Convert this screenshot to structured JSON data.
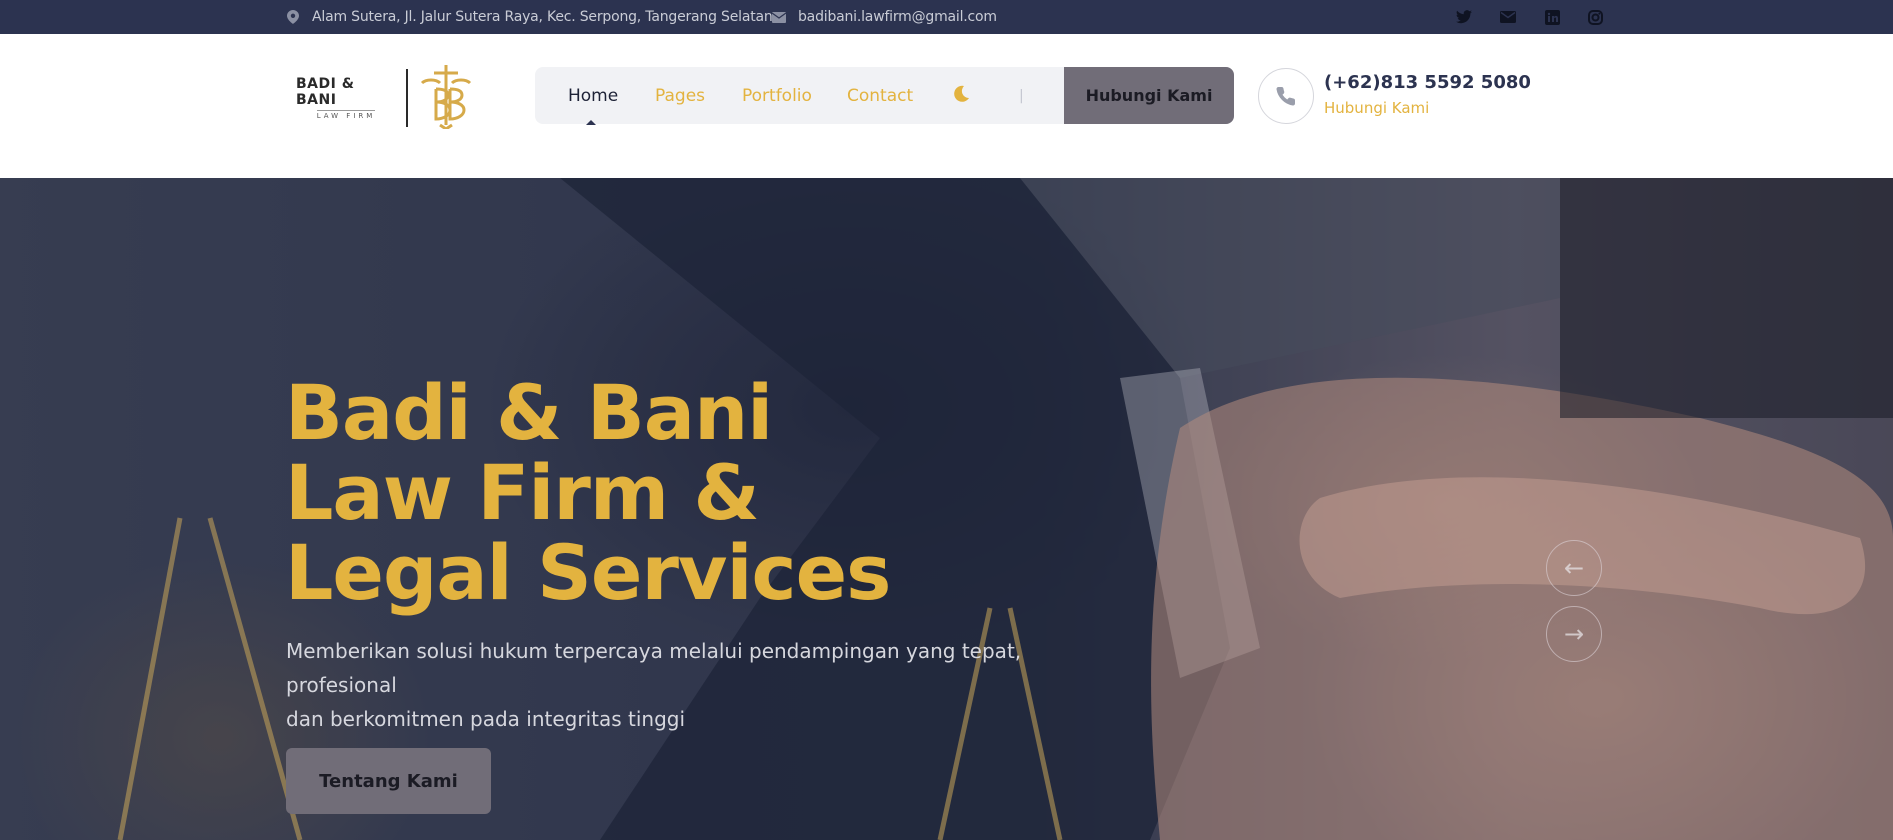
{
  "topbar": {
    "address": "Alam Sutera, Jl. Jalur Sutera Raya, Kec. Serpong, Tangerang Selatan",
    "email": "badibani.lawfirm@gmail.com",
    "social": [
      {
        "icon": "twitter-icon"
      },
      {
        "icon": "mail-icon"
      },
      {
        "icon": "linkedin-icon"
      },
      {
        "icon": "instagram-icon"
      }
    ]
  },
  "logo": {
    "main": "BADI & BANI",
    "sub": "LAW FIRM"
  },
  "nav": {
    "items": [
      {
        "label": "Home",
        "active": true
      },
      {
        "label": "Pages",
        "active": false
      },
      {
        "label": "Portfolio",
        "active": false
      },
      {
        "label": "Contact",
        "active": false
      }
    ],
    "separator": "|",
    "cta_label": "Hubungi Kami"
  },
  "contact": {
    "phone": "(+62)813 5592 5080",
    "label": "Hubungi Kami"
  },
  "hero": {
    "title_lines": [
      "Badi & Bani",
      "Law Firm &",
      "Legal Services"
    ],
    "subtitle_line1": "Memberikan solusi hukum terpercaya melalui pendampingan yang tepat, profesional",
    "subtitle_line2": "dan berkomitmen pada integritas tinggi",
    "button_label": "Tentang Kami",
    "prev_arrow": "←",
    "next_arrow": "→"
  },
  "colors": {
    "topbar_bg": "#2c3350",
    "accent_gold": "#e3b33f",
    "button_bg": "#716d78",
    "nav_bg": "#f1f2f5"
  }
}
